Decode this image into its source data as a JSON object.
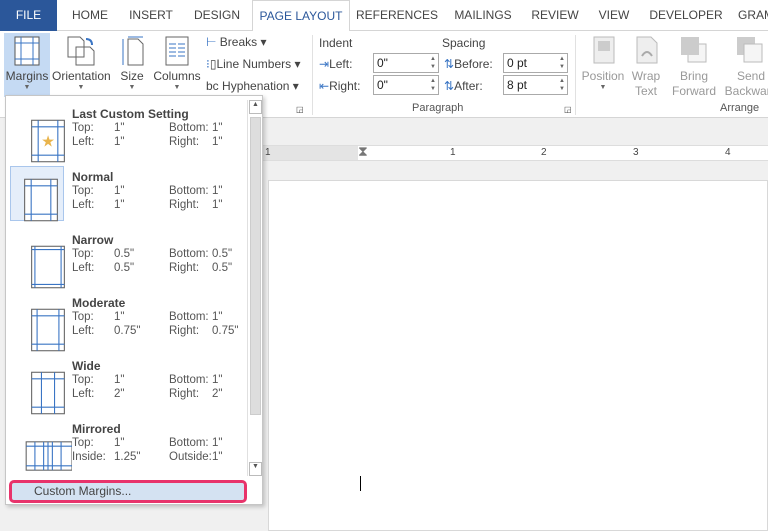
{
  "tabs": [
    "FILE",
    "HOME",
    "INSERT",
    "DESIGN",
    "PAGE LAYOUT",
    "REFERENCES",
    "MAILINGS",
    "REVIEW",
    "VIEW",
    "DEVELOPER",
    "GRAM"
  ],
  "active_tab": "PAGE LAYOUT",
  "page_setup": {
    "margins": "Margins",
    "orientation": "Orientation",
    "size": "Size",
    "columns": "Columns",
    "breaks": "Breaks",
    "line_numbers": "Line Numbers",
    "hyphenation": "Hyphenation"
  },
  "paragraph": {
    "indent": "Indent",
    "spacing": "Spacing",
    "left_label": "Left:",
    "right_label": "Right:",
    "before_label": "Before:",
    "after_label": "After:",
    "left": "0\"",
    "right": "0\"",
    "before": "0 pt",
    "after": "8 pt",
    "group": "Paragraph"
  },
  "arrange": {
    "position": "Position",
    "wrap1": "Wrap",
    "wrap2": "Text",
    "bring1": "Bring",
    "bring2": "Forward",
    "send1": "Send",
    "send2": "Backward",
    "group": "Arrange"
  },
  "ruler": [
    "1",
    "1",
    "2",
    "3",
    "4"
  ],
  "margins_menu": [
    {
      "name": "Last Custom Setting",
      "l1": "Top:",
      "v1": "1\"",
      "l2": "Bottom:",
      "v2": "1\"",
      "l3": "Left:",
      "v3": "1\"",
      "l4": "Right:",
      "v4": "1\""
    },
    {
      "name": "Normal",
      "l1": "Top:",
      "v1": "1\"",
      "l2": "Bottom:",
      "v2": "1\"",
      "l3": "Left:",
      "v3": "1\"",
      "l4": "Right:",
      "v4": "1\""
    },
    {
      "name": "Narrow",
      "l1": "Top:",
      "v1": "0.5\"",
      "l2": "Bottom:",
      "v2": "0.5\"",
      "l3": "Left:",
      "v3": "0.5\"",
      "l4": "Right:",
      "v4": "0.5\""
    },
    {
      "name": "Moderate",
      "l1": "Top:",
      "v1": "1\"",
      "l2": "Bottom:",
      "v2": "1\"",
      "l3": "Left:",
      "v3": "0.75\"",
      "l4": "Right:",
      "v4": "0.75\""
    },
    {
      "name": "Wide",
      "l1": "Top:",
      "v1": "1\"",
      "l2": "Bottom:",
      "v2": "1\"",
      "l3": "Left:",
      "v3": "2\"",
      "l4": "Right:",
      "v4": "2\""
    },
    {
      "name": "Mirrored",
      "l1": "Top:",
      "v1": "1\"",
      "l2": "Bottom:",
      "v2": "1\"",
      "l3": "Inside:",
      "v3": "1.25\"",
      "l4": "Outside:",
      "v4": "1\""
    }
  ],
  "custom_margins": "Custom Margins...",
  "colors": {
    "file_tab": "#2b579a",
    "highlight_border": "#e8336b",
    "selected": "#c5daf3"
  }
}
